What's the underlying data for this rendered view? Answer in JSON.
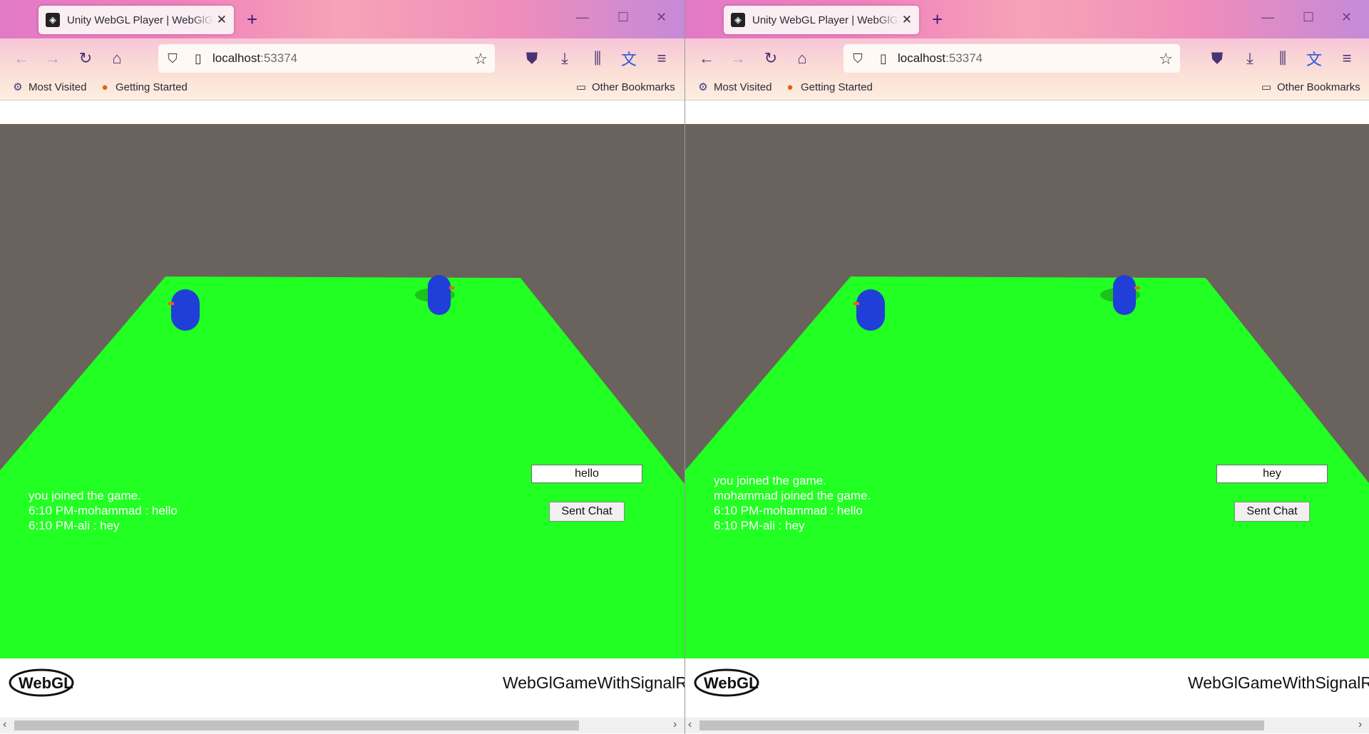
{
  "windows": [
    {
      "tab_title": "Unity WebGL Player | WebGlGameWithSignalR",
      "url_host": "localhost",
      "url_port": ":53374",
      "bookmarks": {
        "most_visited": "Most Visited",
        "getting_started": "Getting Started",
        "other": "Other Bookmarks"
      },
      "chat_lines": [
        "you joined the game.",
        "6:10 PM-mohammad : hello",
        "6:10 PM-ali : hey"
      ],
      "chat_input_value": "hello",
      "send_button_label": "Sent Chat",
      "game_title": "WebGlGameWithSignalR"
    },
    {
      "tab_title": "Unity WebGL Player | WebGlGameWithSignalR",
      "url_host": "localhost",
      "url_port": ":53374",
      "bookmarks": {
        "most_visited": "Most Visited",
        "getting_started": "Getting Started",
        "other": "Other Bookmarks"
      },
      "chat_lines": [
        "you joined the game.",
        "mohammad joined the game.",
        "6:10 PM-mohammad : hello",
        "6:10 PM-ali : hey"
      ],
      "chat_input_value": "hey",
      "send_button_label": "Sent Chat",
      "game_title": "WebGlGameWithSignalR"
    }
  ],
  "colors": {
    "ground": "#22ff22",
    "sky": "#6a625d",
    "player": "#1f3fd8",
    "accent": "#3c1a7a"
  },
  "icons": [
    "unity-favicon",
    "new-tab-icon",
    "minimize-icon",
    "maximize-icon",
    "close-icon",
    "back-icon",
    "forward-icon",
    "reload-icon",
    "home-icon",
    "shield-icon",
    "page-icon",
    "star-icon",
    "pocket-icon",
    "download-icon",
    "library-icon",
    "translate-icon",
    "menu-icon",
    "gear-icon",
    "firefox-icon",
    "folder-icon",
    "webgl-logo"
  ]
}
